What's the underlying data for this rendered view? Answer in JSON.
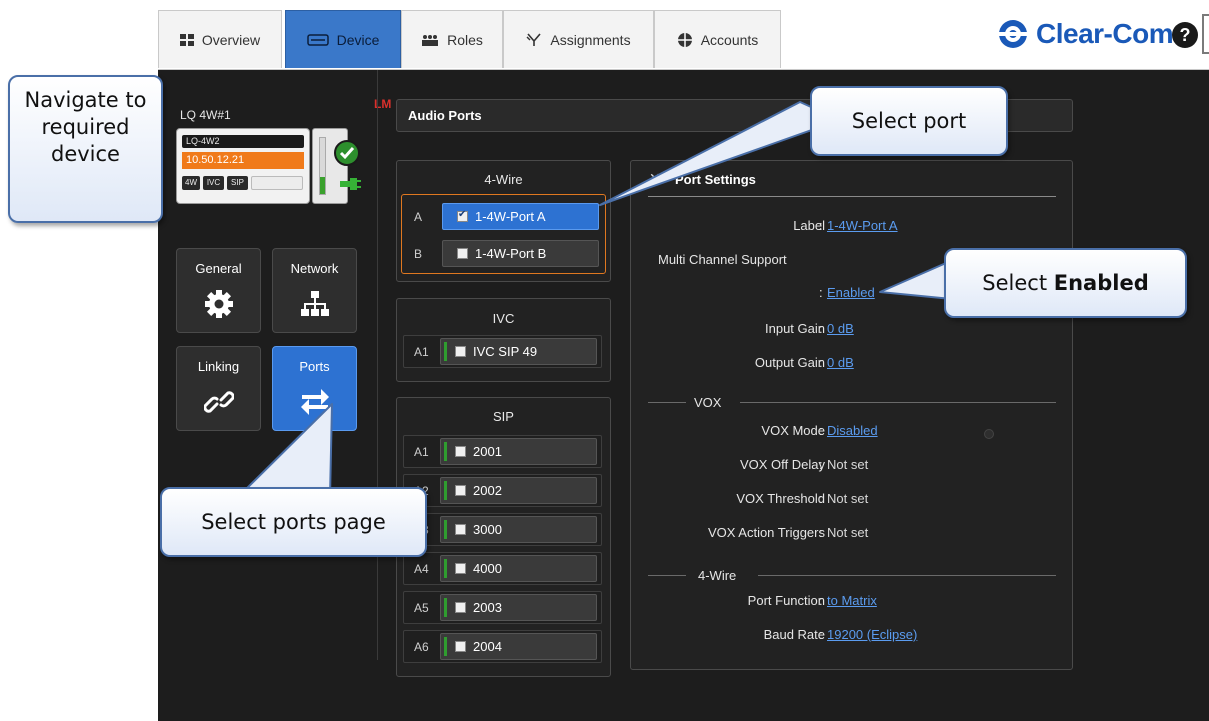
{
  "topbar": {
    "tabs": [
      {
        "label": "Overview",
        "icon": "overview-grid-icon"
      },
      {
        "label": "Device",
        "icon": "device-icon",
        "active": true
      },
      {
        "label": "Roles",
        "icon": "roles-icon"
      },
      {
        "label": "Assignments",
        "icon": "assignments-icon"
      },
      {
        "label": "Accounts",
        "icon": "accounts-icon"
      }
    ],
    "brand": "Clear-Com",
    "help_label": "?"
  },
  "device": {
    "badge": "LM",
    "name": "LQ 4W#1",
    "model": "LQ-4W2",
    "ip": "10.50.12.21",
    "chips": [
      "4W",
      "IVC",
      "SIP"
    ],
    "status_icon": "check-circle-icon",
    "link_icon": "network-plug-icon",
    "meter_level": 0.3
  },
  "nav": {
    "tiles": [
      {
        "label": "General",
        "icon": "gear-icon"
      },
      {
        "label": "Network",
        "icon": "network-tree-icon"
      },
      {
        "label": "Linking",
        "icon": "link-icon"
      },
      {
        "label": "Ports",
        "icon": "ports-arrows-icon",
        "active": true
      }
    ]
  },
  "audio_ports": {
    "title": "Audio Ports",
    "groups": {
      "fourwire": {
        "title": "4-Wire",
        "rows": [
          {
            "id": "A",
            "label": "1-4W-Port A",
            "checked": true,
            "selected": true
          },
          {
            "id": "B",
            "label": "1-4W-Port B",
            "checked": false
          }
        ]
      },
      "ivc": {
        "title": "IVC",
        "rows": [
          {
            "id": "A1",
            "label": "IVC SIP 49",
            "checked": false
          }
        ]
      },
      "sip": {
        "title": "SIP",
        "rows": [
          {
            "id": "A1",
            "label": "2001",
            "checked": false
          },
          {
            "id": "A2",
            "label": "2002",
            "checked": false
          },
          {
            "id": "A3",
            "label": "3000",
            "checked": false
          },
          {
            "id": "A4",
            "label": "4000",
            "checked": false
          },
          {
            "id": "A5",
            "label": "2003",
            "checked": false
          },
          {
            "id": "A6",
            "label": "2004",
            "checked": false
          }
        ]
      }
    }
  },
  "port_settings": {
    "collapse_glyph": "✕",
    "title": "Port Settings",
    "label_label": "Label",
    "label_value": "1-4W-Port A",
    "multi_channel_label": "Multi Channel Support",
    "multi_channel_value": "Enabled",
    "input_gain_label": "Input Gain",
    "input_gain_value": "0 dB",
    "output_gain_label": "Output Gain",
    "output_gain_value": "0 dB",
    "vox_section": "VOX",
    "vox_mode_label": "VOX Mode",
    "vox_mode_value": "Disabled",
    "vox_off_delay_label": "VOX Off Delay",
    "vox_off_delay_value": "Not set",
    "vox_threshold_label": "VOX Threshold",
    "vox_threshold_value": "Not set",
    "vox_triggers_label": "VOX Action Triggers",
    "vox_triggers_value": "Not set",
    "fourwire_section": "4-Wire",
    "port_function_label": "Port Function",
    "port_function_value": "to Matrix",
    "baud_rate_label": "Baud Rate",
    "baud_rate_value": "19200 (Eclipse)"
  },
  "callouts": {
    "navigate": "Navigate to required device",
    "select_port": "Select port",
    "select_enabled_prefix": "Select",
    "select_enabled_bold": "Enabled",
    "select_ports_page": "Select ports page"
  },
  "colors": {
    "app_background": "#1d1d1d",
    "active_blue": "#2d72d2",
    "link_blue": "#5b9cf0",
    "ip_orange": "#f07a1a",
    "status_green": "#3aa12d",
    "lm_red": "#d9302c"
  }
}
